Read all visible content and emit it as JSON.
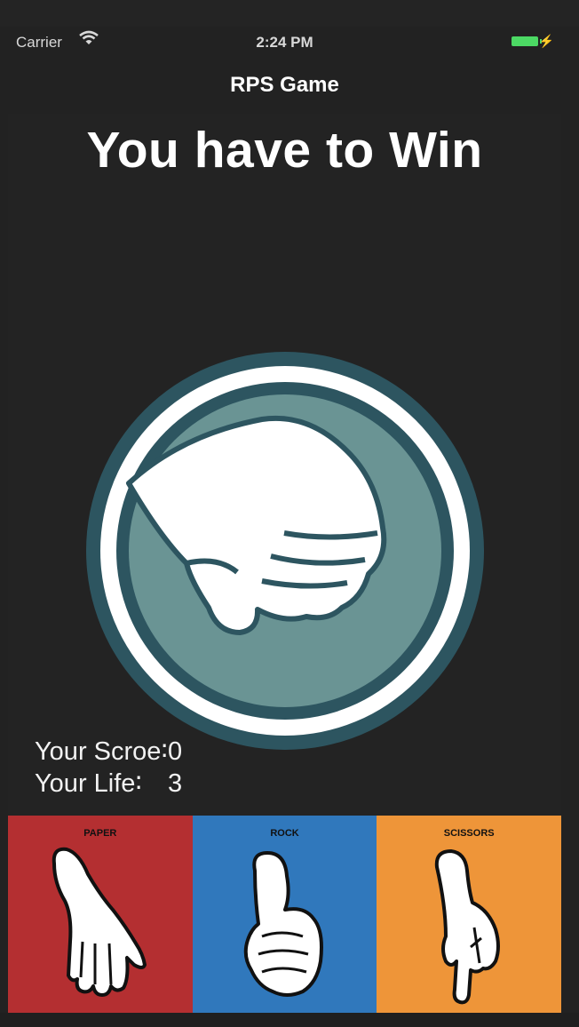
{
  "status_bar": {
    "carrier": "Carrier",
    "time": "2:24 PM",
    "battery_color": "#4cd964"
  },
  "nav": {
    "title": "RPS Game"
  },
  "main": {
    "headline": "You have to Win",
    "hero_icon": "paper-hand-icon",
    "colors": {
      "ring": "#2d5560",
      "inner": "#6a9494",
      "hand": "#ffffff"
    }
  },
  "stats": {
    "score_label": "Your Scroe∶",
    "score_value": "0",
    "life_label": "Your Life∶",
    "life_value": "3"
  },
  "choices": [
    {
      "label": "PAPER",
      "color": "#b42f31",
      "icon": "paper-hand-icon"
    },
    {
      "label": "ROCK",
      "color": "#3078bc",
      "icon": "rock-fist-icon"
    },
    {
      "label": "SCISSORS",
      "color": "#ee9539",
      "icon": "scissors-hand-icon"
    }
  ]
}
